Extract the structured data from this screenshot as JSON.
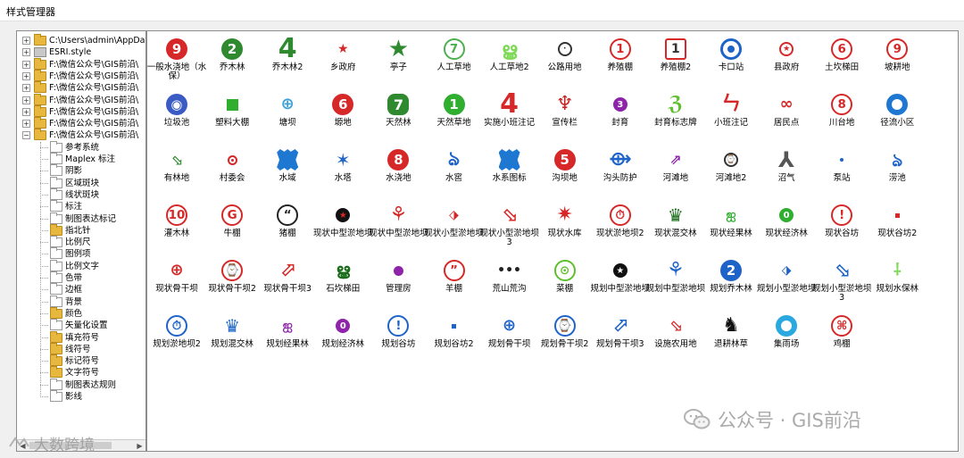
{
  "window": {
    "title": "样式管理器"
  },
  "tree": {
    "items": [
      {
        "label": "C:\\Users\\admin\\AppData\\",
        "type": "yellow",
        "expander": "+",
        "indent": 0
      },
      {
        "label": "ESRI.style",
        "type": "gray",
        "expander": "+",
        "indent": 0
      },
      {
        "label": "F:\\微信公众号\\GIS前沿\\",
        "type": "yellow",
        "expander": "+",
        "indent": 0
      },
      {
        "label": "F:\\微信公众号\\GIS前沿\\",
        "type": "yellow",
        "expander": "+",
        "indent": 0
      },
      {
        "label": "F:\\微信公众号\\GIS前沿\\",
        "type": "yellow",
        "expander": "+",
        "indent": 0
      },
      {
        "label": "F:\\微信公众号\\GIS前沿\\",
        "type": "yellow",
        "expander": "+",
        "indent": 0
      },
      {
        "label": "F:\\微信公众号\\GIS前沿\\",
        "type": "yellow",
        "expander": "+",
        "indent": 0
      },
      {
        "label": "F:\\微信公众号\\GIS前沿\\",
        "type": "yellow",
        "expander": "+",
        "indent": 0
      },
      {
        "label": "F:\\微信公众号\\GIS前沿\\",
        "type": "yellow",
        "expander": "−",
        "indent": 0
      },
      {
        "label": "参考系统",
        "type": "white",
        "indent": 1
      },
      {
        "label": "Maplex 标注",
        "type": "white",
        "indent": 1
      },
      {
        "label": "阴影",
        "type": "white",
        "indent": 1
      },
      {
        "label": "区域斑块",
        "type": "white",
        "indent": 1
      },
      {
        "label": "线状斑块",
        "type": "white",
        "indent": 1
      },
      {
        "label": "标注",
        "type": "white",
        "indent": 1
      },
      {
        "label": "制图表达标记",
        "type": "white",
        "indent": 1
      },
      {
        "label": "指北针",
        "type": "yellow",
        "indent": 1
      },
      {
        "label": "比例尺",
        "type": "white",
        "indent": 1
      },
      {
        "label": "图例项",
        "type": "white",
        "indent": 1
      },
      {
        "label": "比例文字",
        "type": "white",
        "indent": 1
      },
      {
        "label": "色带",
        "type": "white",
        "indent": 1
      },
      {
        "label": "边框",
        "type": "white",
        "indent": 1
      },
      {
        "label": "背景",
        "type": "white",
        "indent": 1
      },
      {
        "label": "颜色",
        "type": "yellow",
        "indent": 1
      },
      {
        "label": "矢量化设置",
        "type": "white",
        "indent": 1
      },
      {
        "label": "填充符号",
        "type": "yellow",
        "indent": 1
      },
      {
        "label": "线符号",
        "type": "yellow",
        "indent": 1
      },
      {
        "label": "标记符号",
        "type": "yellow",
        "indent": 1
      },
      {
        "label": "文字符号",
        "type": "yellow",
        "indent": 1
      },
      {
        "label": "制图表达规则",
        "type": "white",
        "indent": 1
      },
      {
        "label": "影线",
        "type": "white",
        "indent": 1
      }
    ]
  },
  "symbols": [
    {
      "label": "一般水浇地（水保）",
      "kind": "circle",
      "text": "9",
      "bg": "#d62828",
      "fg": "#ffffff"
    },
    {
      "label": "乔木林",
      "kind": "circle",
      "text": "2",
      "bg": "#2f8a2f",
      "fg": "#ffffff"
    },
    {
      "label": "乔木林2",
      "kind": "text",
      "text": "4",
      "fg": "#2f8a2f"
    },
    {
      "label": "乡政府",
      "kind": "glyph",
      "text": "★",
      "fg": "#d62828",
      "size": 14
    },
    {
      "label": "亭子",
      "kind": "glyph",
      "text": "★",
      "fg": "#2f8a2f",
      "size": 26
    },
    {
      "label": "人工草地",
      "kind": "ring",
      "text": "7",
      "fg": "#4caf50"
    },
    {
      "label": "人工草地2",
      "kind": "glyph",
      "text": "ൠ",
      "fg": "#7ed957",
      "size": 20
    },
    {
      "label": "公路用地",
      "kind": "ring",
      "text": "·",
      "fg": "#333333",
      "small": true
    },
    {
      "label": "养殖棚",
      "kind": "ring",
      "text": "1",
      "fg": "#d62828"
    },
    {
      "label": "养殖棚2",
      "kind": "box",
      "text": "1",
      "fg": "#d62828"
    },
    {
      "label": "卡口站",
      "kind": "target",
      "fg": "#1e64c8"
    },
    {
      "label": "县政府",
      "kind": "ring",
      "text": "★",
      "fg": "#d62828",
      "small": true
    },
    {
      "label": "土坎梯田",
      "kind": "ring",
      "text": "6",
      "fg": "#d62828"
    },
    {
      "label": "坡耕地",
      "kind": "ring",
      "text": "9",
      "fg": "#d62828"
    },
    {
      "label": "垃圾池",
      "kind": "circle",
      "text": "◉",
      "bg": "#3a5bc4",
      "fg": "#ffffff"
    },
    {
      "label": "塑料大棚",
      "kind": "square",
      "bg": "#2fae2f"
    },
    {
      "label": "塘坝",
      "kind": "glyph",
      "text": "⊕",
      "fg": "#3aa0d8",
      "size": 18
    },
    {
      "label": "塬地",
      "kind": "circle",
      "text": "6",
      "bg": "#d62828",
      "fg": "#ffffff"
    },
    {
      "label": "天然林",
      "kind": "rsq",
      "text": "7",
      "bg": "#2f8a2f",
      "fg": "#ffffff"
    },
    {
      "label": "天然草地",
      "kind": "circle",
      "text": "1",
      "bg": "#2fae2f",
      "fg": "#ffffff"
    },
    {
      "label": "实施小班注记",
      "kind": "text",
      "text": "4",
      "fg": "#d62828"
    },
    {
      "label": "宣传栏",
      "kind": "glyph",
      "text": "♆",
      "fg": "#c62828",
      "size": 22
    },
    {
      "label": "封育",
      "kind": "circle",
      "text": "3",
      "bg": "#8e24aa",
      "fg": "#ffffff",
      "small": true
    },
    {
      "label": "封育标志牌",
      "kind": "glyph",
      "text": "ℨ",
      "fg": "#5fbf2f",
      "size": 22
    },
    {
      "label": "小班注记",
      "kind": "glyph",
      "text": "ㄣ",
      "fg": "#d62828",
      "size": 22
    },
    {
      "label": "居民点",
      "kind": "glyph",
      "text": "∞",
      "fg": "#d62828",
      "size": 18
    },
    {
      "label": "川台地",
      "kind": "ring",
      "text": "8",
      "fg": "#d62828"
    },
    {
      "label": "径流小区",
      "kind": "donut",
      "bg": "#1e78d2"
    },
    {
      "label": "有林地",
      "kind": "glyph",
      "text": "⬂",
      "fg": "#2f8a2f",
      "size": 16
    },
    {
      "label": "村委会",
      "kind": "target-small",
      "fg": "#d62828"
    },
    {
      "label": "水域",
      "kind": "blob",
      "bg": "#1e78d2"
    },
    {
      "label": "水塔",
      "kind": "glyph",
      "text": "✶",
      "fg": "#1e64c8",
      "size": 20
    },
    {
      "label": "水浇地",
      "kind": "circle",
      "text": "8",
      "bg": "#d62828",
      "fg": "#ffffff"
    },
    {
      "label": "水窖",
      "kind": "glyph",
      "text": "ঌ",
      "fg": "#1e64c8",
      "size": 22
    },
    {
      "label": "水系图标",
      "kind": "blob",
      "bg": "#1e78d2"
    },
    {
      "label": "沟坝地",
      "kind": "circle",
      "text": "5",
      "bg": "#d62828",
      "fg": "#ffffff"
    },
    {
      "label": "沟头防护",
      "kind": "glyph",
      "text": "⟴",
      "fg": "#1e64c8",
      "size": 22
    },
    {
      "label": "河滩地",
      "kind": "glyph",
      "text": "⇗",
      "fg": "#8e24aa",
      "size": 16
    },
    {
      "label": "河滩地2",
      "kind": "ring",
      "text": "⌚",
      "fg": "#333333",
      "small": true
    },
    {
      "label": "沼气",
      "kind": "glyph",
      "text": "⅄",
      "fg": "#555555",
      "size": 24
    },
    {
      "label": "泵站",
      "kind": "dot",
      "bg": "#1e64c8"
    },
    {
      "label": "涝池",
      "kind": "glyph",
      "text": "ঌ",
      "fg": "#1e64c8",
      "size": 20
    },
    {
      "label": "灌木林",
      "kind": "ring",
      "text": "10",
      "fg": "#d62828"
    },
    {
      "label": "牛棚",
      "kind": "ring",
      "text": "G",
      "fg": "#d62828"
    },
    {
      "label": "猪棚",
      "kind": "ring",
      "text": "“",
      "fg": "#222222"
    },
    {
      "label": "现状中型淤地坝",
      "kind": "circle",
      "text": "★",
      "bg": "#111111",
      "fg": "#d62828",
      "small": true
    },
    {
      "label": "现状中型淤地坝",
      "kind": "glyph",
      "text": "⚘",
      "fg": "#d62828",
      "size": 22
    },
    {
      "label": "现状小型淤地坝",
      "kind": "glyph",
      "text": "⬗",
      "fg": "#d62828",
      "size": 14
    },
    {
      "label": "现状小型淤地坝3",
      "kind": "glyph",
      "text": "⬂",
      "fg": "#d62828",
      "size": 22
    },
    {
      "label": "现状水库",
      "kind": "glyph",
      "text": "✷",
      "fg": "#d62828",
      "size": 22
    },
    {
      "label": "现状淤地坝2",
      "kind": "ring",
      "text": "⏱",
      "fg": "#d62828"
    },
    {
      "label": "现状混交林",
      "kind": "glyph",
      "text": "♛",
      "fg": "#1a6b1a",
      "size": 20
    },
    {
      "label": "现状经果林",
      "kind": "glyph",
      "text": "ஐ",
      "fg": "#2fae2f",
      "size": 14
    },
    {
      "label": "现状经济林",
      "kind": "circle",
      "text": "0",
      "bg": "#2fae2f",
      "fg": "#ffffff",
      "small": true
    },
    {
      "label": "现状谷坊",
      "kind": "ring",
      "text": "!",
      "fg": "#d62828"
    },
    {
      "label": "现状谷坊2",
      "kind": "square-small",
      "bg": "#d62828"
    },
    {
      "label": "现状骨干坝",
      "kind": "glyph",
      "text": "⊕",
      "fg": "#d62828",
      "size": 18
    },
    {
      "label": "现状骨干坝2",
      "kind": "ring",
      "text": "⌚",
      "fg": "#d62828"
    },
    {
      "label": "现状骨干坝3",
      "kind": "glyph",
      "text": "⬀",
      "fg": "#d62828",
      "size": 22
    },
    {
      "label": "石坎梯田",
      "kind": "glyph",
      "text": "ൠ",
      "fg": "#1a6b1a",
      "size": 18
    },
    {
      "label": "管理房",
      "kind": "dot-big",
      "bg": "#8e24aa"
    },
    {
      "label": "羊棚",
      "kind": "ring",
      "text": "”",
      "fg": "#d62828"
    },
    {
      "label": "荒山荒沟",
      "kind": "text",
      "text": "•••",
      "fg": "#222222",
      "small": true
    },
    {
      "label": "菜棚",
      "kind": "ring",
      "text": "⊙",
      "fg": "#5fbf2f"
    },
    {
      "label": "规划中型淤地坝",
      "kind": "circle",
      "text": "★",
      "bg": "#111111",
      "fg": "#ffffff",
      "small": true
    },
    {
      "label": "规划中型淤地坝",
      "kind": "glyph",
      "text": "⚘",
      "fg": "#1e64c8",
      "size": 22
    },
    {
      "label": "规划乔木林",
      "kind": "circle",
      "text": "2",
      "bg": "#1e64c8",
      "fg": "#ffffff"
    },
    {
      "label": "规划小型淤地坝",
      "kind": "glyph",
      "text": "⬗",
      "fg": "#1e64c8",
      "size": 14
    },
    {
      "label": "规划小型淤地坝3",
      "kind": "glyph",
      "text": "⬂",
      "fg": "#1e64c8",
      "size": 22
    },
    {
      "label": "规划水保林",
      "kind": "glyph",
      "text": "⸸",
      "fg": "#7ed957",
      "size": 18
    },
    {
      "label": "规划淤地坝2",
      "kind": "ring",
      "text": "⏱",
      "fg": "#1e64c8"
    },
    {
      "label": "规划混交林",
      "kind": "glyph",
      "text": "♛",
      "fg": "#1e64c8",
      "size": 20
    },
    {
      "label": "规划经果林",
      "kind": "glyph",
      "text": "ஐ",
      "fg": "#8e24aa",
      "size": 14
    },
    {
      "label": "规划经济林",
      "kind": "circle",
      "text": "0",
      "bg": "#8e24aa",
      "fg": "#ffffff",
      "small": true
    },
    {
      "label": "规划谷坊",
      "kind": "ring",
      "text": "!",
      "fg": "#1e64c8"
    },
    {
      "label": "规划谷坊2",
      "kind": "square-small",
      "bg": "#1e64c8"
    },
    {
      "label": "规划骨干坝",
      "kind": "glyph",
      "text": "⊕",
      "fg": "#1e64c8",
      "size": 18
    },
    {
      "label": "规划骨干坝2",
      "kind": "ring",
      "text": "⌚",
      "fg": "#1e64c8"
    },
    {
      "label": "规划骨干坝3",
      "kind": "glyph",
      "text": "⬀",
      "fg": "#1e64c8",
      "size": 22
    },
    {
      "label": "设施农用地",
      "kind": "glyph",
      "text": "⬂",
      "fg": "#d62828",
      "size": 18
    },
    {
      "label": "退耕林草",
      "kind": "glyph",
      "text": "♞",
      "fg": "#111111",
      "size": 22
    },
    {
      "label": "集雨场",
      "kind": "donut",
      "bg": "#2aa8e0"
    },
    {
      "label": "鸡棚",
      "kind": "ring",
      "text": "⌘",
      "fg": "#d62828"
    }
  ],
  "watermark": {
    "main": "公众号 · GIS前沿",
    "secondary": "大数跨境"
  }
}
